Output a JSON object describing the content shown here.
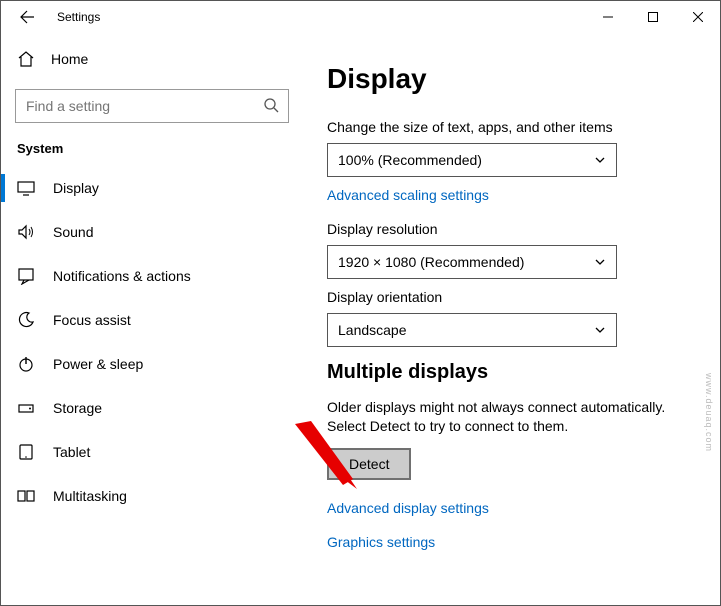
{
  "titlebar": {
    "title": "Settings"
  },
  "sidebar": {
    "home": "Home",
    "search_placeholder": "Find a setting",
    "group": "System",
    "items": [
      {
        "label": "Display",
        "icon": "display"
      },
      {
        "label": "Sound",
        "icon": "sound"
      },
      {
        "label": "Notifications & actions",
        "icon": "notifications"
      },
      {
        "label": "Focus assist",
        "icon": "focus"
      },
      {
        "label": "Power & sleep",
        "icon": "power"
      },
      {
        "label": "Storage",
        "icon": "storage"
      },
      {
        "label": "Tablet",
        "icon": "tablet"
      },
      {
        "label": "Multitasking",
        "icon": "multitask"
      }
    ]
  },
  "content": {
    "heading": "Display",
    "scale_label": "Change the size of text, apps, and other items",
    "scale_value": "100% (Recommended)",
    "adv_scaling": "Advanced scaling settings",
    "res_label": "Display resolution",
    "res_value": "1920 × 1080 (Recommended)",
    "orient_label": "Display orientation",
    "orient_value": "Landscape",
    "multi_heading": "Multiple displays",
    "multi_para": "Older displays might not always connect automatically. Select Detect to try to connect to them.",
    "detect_btn": "Detect",
    "adv_display": "Advanced display settings",
    "graphics": "Graphics settings"
  },
  "watermark": "www.deuaq.com"
}
